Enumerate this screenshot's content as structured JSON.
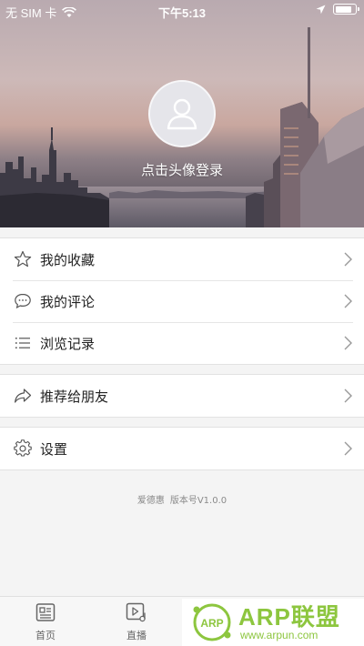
{
  "status_bar": {
    "carrier": "无 SIM 卡",
    "time": "下午5:13",
    "battery_level": 0.85
  },
  "profile": {
    "login_prompt": "点击头像登录"
  },
  "menu": {
    "group1": [
      {
        "label": "我的收藏",
        "icon": "star-icon"
      },
      {
        "label": "我的评论",
        "icon": "comment-icon"
      },
      {
        "label": "浏览记录",
        "icon": "list-icon"
      }
    ],
    "group2": [
      {
        "label": "推荐给朋友",
        "icon": "share-icon"
      }
    ],
    "group3": [
      {
        "label": "设置",
        "icon": "gear-icon"
      }
    ]
  },
  "version": {
    "app_name": "爱德惠",
    "version_text": "版本号V1.0.0"
  },
  "tabbar": {
    "tabs": [
      {
        "label": "首页",
        "icon": "news-icon"
      },
      {
        "label": "直播",
        "icon": "live-icon"
      }
    ]
  },
  "watermark": {
    "brand": "ARP联盟",
    "badge": "ARP",
    "url": "www.arpun.com",
    "color": "#8dc63f"
  }
}
